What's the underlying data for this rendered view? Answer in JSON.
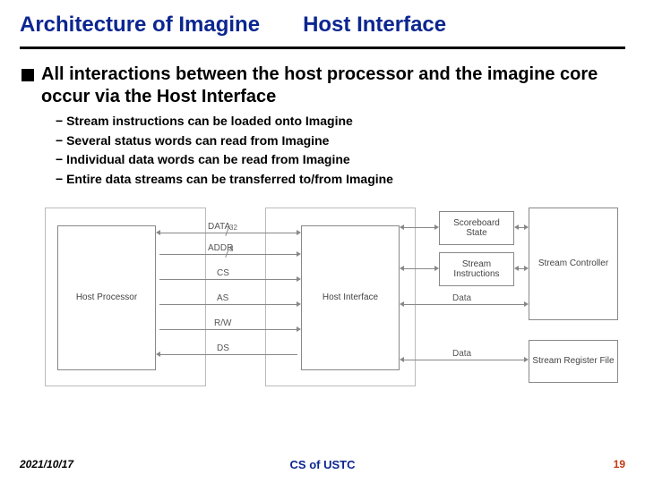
{
  "title": {
    "left": "Architecture of Imagine",
    "right": "Host Interface"
  },
  "bullet": "All interactions between the host processor and the imagine core occur via the Host Interface",
  "subs": [
    "Stream instructions can be loaded onto Imagine",
    "Several status words can read from Imagine",
    "Individual data words can be read from Imagine",
    "Entire data streams can be transferred to/from Imagine"
  ],
  "diagram": {
    "hostProc": "Host Processor",
    "hostIf": "Host Interface",
    "scoreboard": "Scoreboard\nState",
    "streamInstr": "Stream\nInstructions",
    "streamCtrl": "Stream Controller",
    "srf": "Stream Register File",
    "sig": {
      "data": "DATA",
      "addr": "ADDR",
      "cs": "CS",
      "as": "AS",
      "rw": "R/W",
      "ds": "DS",
      "dataR": "Data",
      "dataSRF": "Data"
    },
    "widths": {
      "data": "32",
      "addr": "8"
    }
  },
  "footer": {
    "date": "2021/10/17",
    "center": "CS of USTC",
    "page": "19"
  }
}
